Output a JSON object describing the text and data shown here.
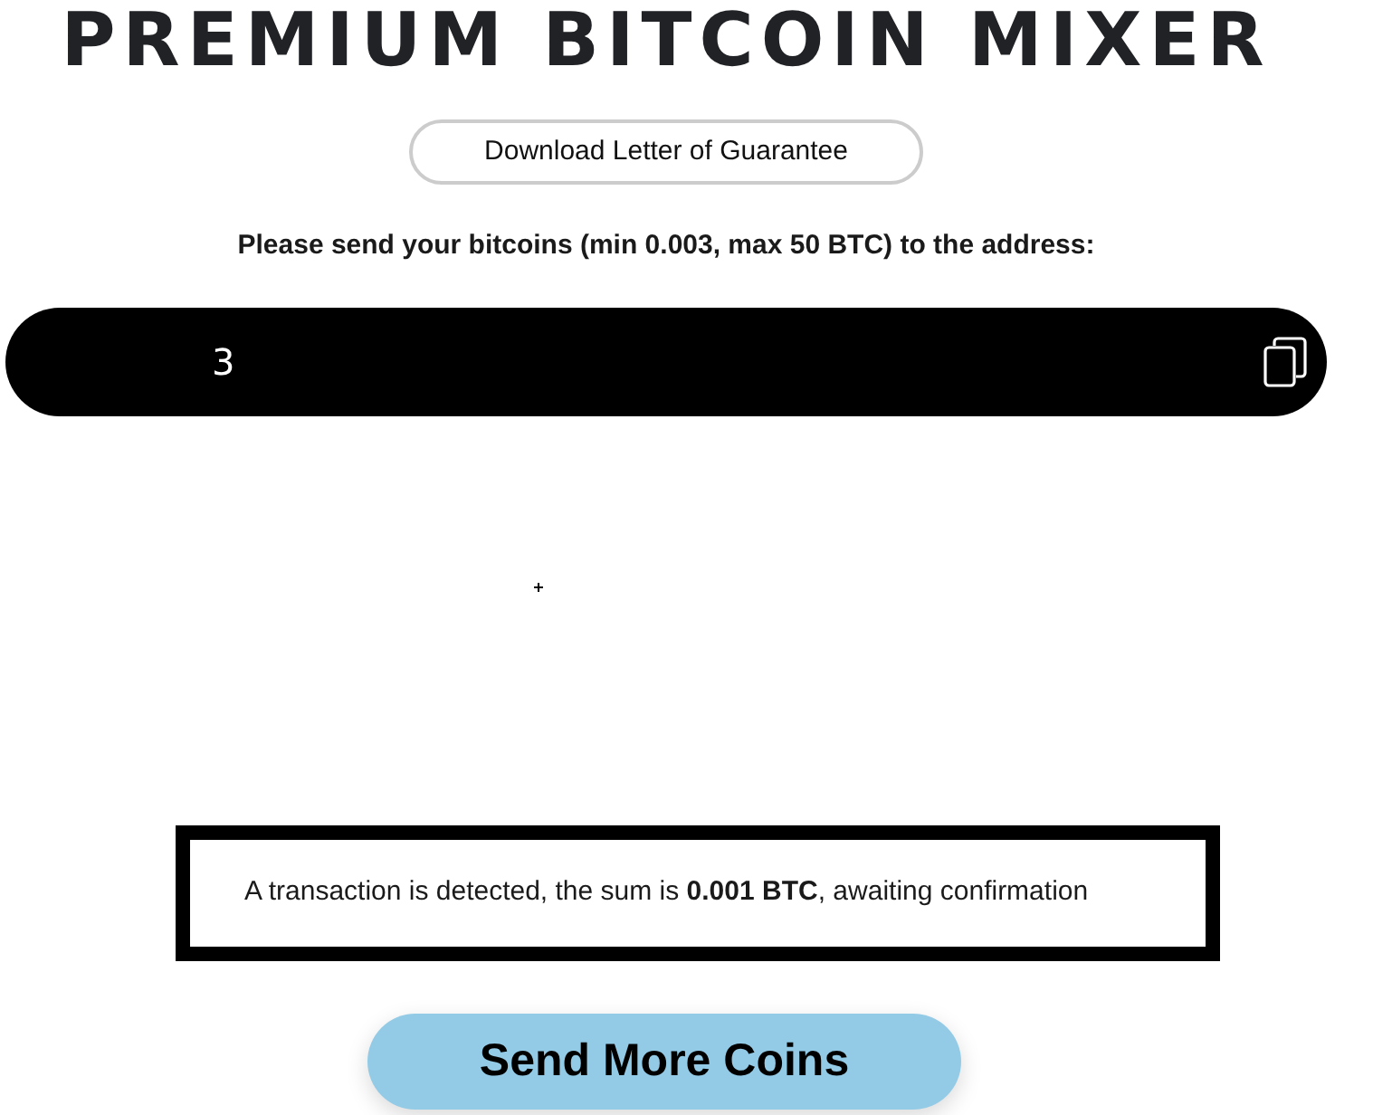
{
  "title": "PREMIUM BITCOIN MIXER",
  "guarantee_button": "Download Letter of Guarantee",
  "instruction": "Please send your bitcoins (min 0.003, max 50 BTC) to the address:",
  "address_field": {
    "value": "3"
  },
  "status_message": "A transaction is detected, the sum is **0.001 BTC**, awaiting confirmation",
  "send_more_button": "Send More Coins"
}
